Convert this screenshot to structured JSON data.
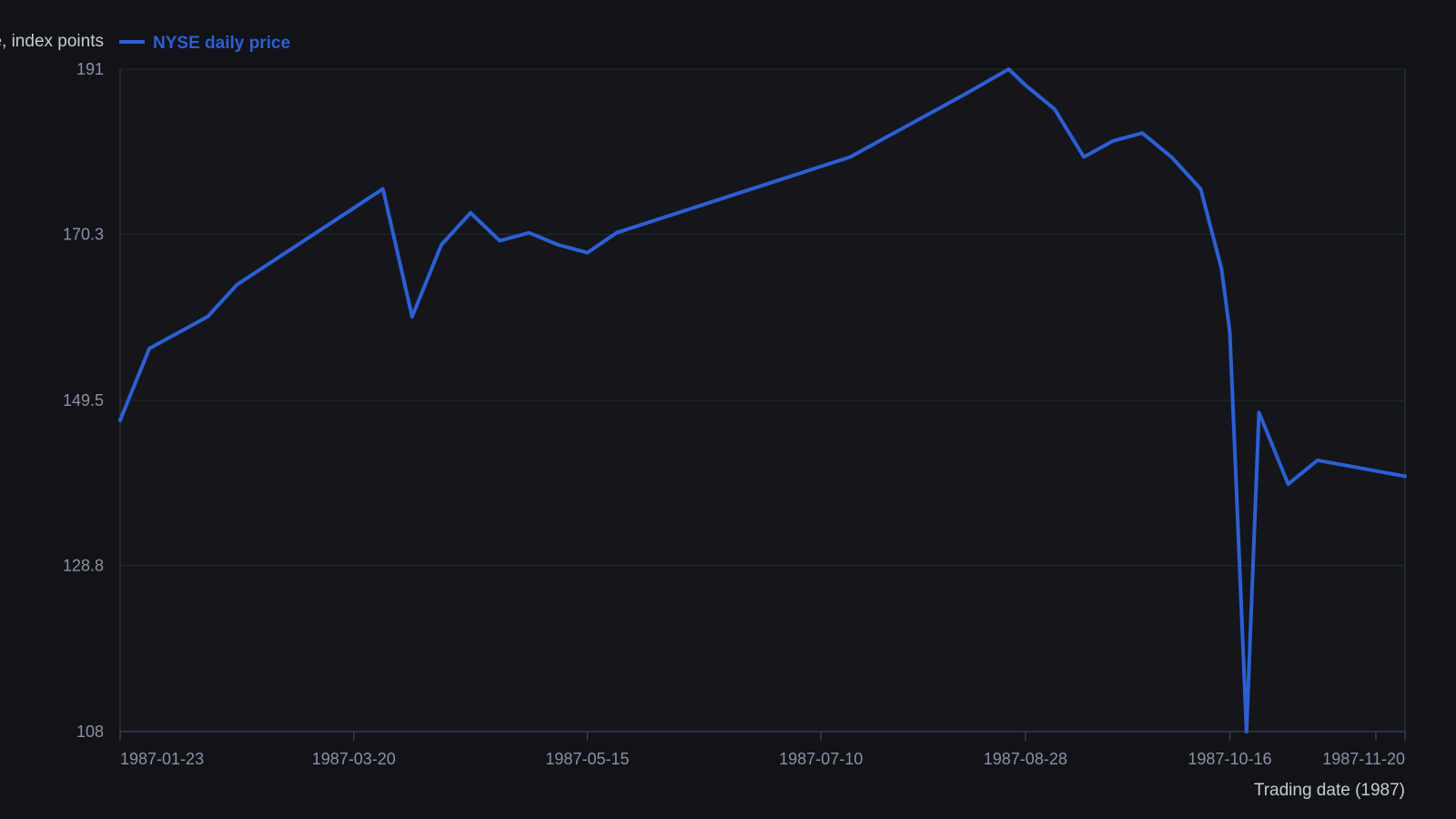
{
  "colors": {
    "background": "#111318",
    "plot_background": "#14161c",
    "series_line": "#2d5fd3",
    "gridline": "#262930",
    "axis_line": "#3a3d45",
    "tick_text": "#8d929b",
    "title_text": "#c9ccd2"
  },
  "legend": {
    "placement": "top-left",
    "icon": "line-swatch"
  },
  "chart_data": {
    "type": "line",
    "title": "",
    "xlabel": "Trading date (1987)",
    "ylabel": "Close, index points",
    "ylim": [
      108,
      191
    ],
    "xlim": [
      "1987-01-23",
      "1987-11-27"
    ],
    "grid": {
      "y": true,
      "x": false
    },
    "y_ticks": [
      "108",
      "128.8",
      "149.5",
      "170.3",
      "191"
    ],
    "x_ticks": [
      "1987-01-23",
      "1987-03-20",
      "1987-05-15",
      "1987-07-10",
      "1987-08-28",
      "1987-10-16",
      "1987-11-20"
    ],
    "series": [
      {
        "name": "NYSE daily price",
        "x": [
          "1987-01-23",
          "1987-01-30",
          "1987-02-13",
          "1987-02-20",
          "1987-03-27",
          "1987-04-03",
          "1987-04-10",
          "1987-04-17",
          "1987-04-24",
          "1987-05-01",
          "1987-05-08",
          "1987-05-15",
          "1987-05-22",
          "1987-07-17",
          "1987-07-24",
          "1987-08-07",
          "1987-08-14",
          "1987-08-24",
          "1987-08-28",
          "1987-09-04",
          "1987-09-11",
          "1987-09-18",
          "1987-09-25",
          "1987-10-02",
          "1987-10-09",
          "1987-10-14",
          "1987-10-16",
          "1987-10-20",
          "1987-10-23",
          "1987-10-30",
          "1987-11-06",
          "1987-11-27"
        ],
        "values": [
          147.0,
          156.0,
          160.0,
          164.0,
          176.0,
          160.0,
          169.0,
          173.0,
          169.5,
          170.5,
          169.0,
          168.0,
          170.5,
          180.0,
          182.0,
          186.0,
          188.0,
          191.0,
          189.0,
          186.0,
          180.0,
          182.0,
          183.0,
          180.0,
          176.0,
          166.0,
          158.0,
          108.0,
          148.0,
          139.0,
          142.0,
          140.0
        ]
      }
    ]
  }
}
